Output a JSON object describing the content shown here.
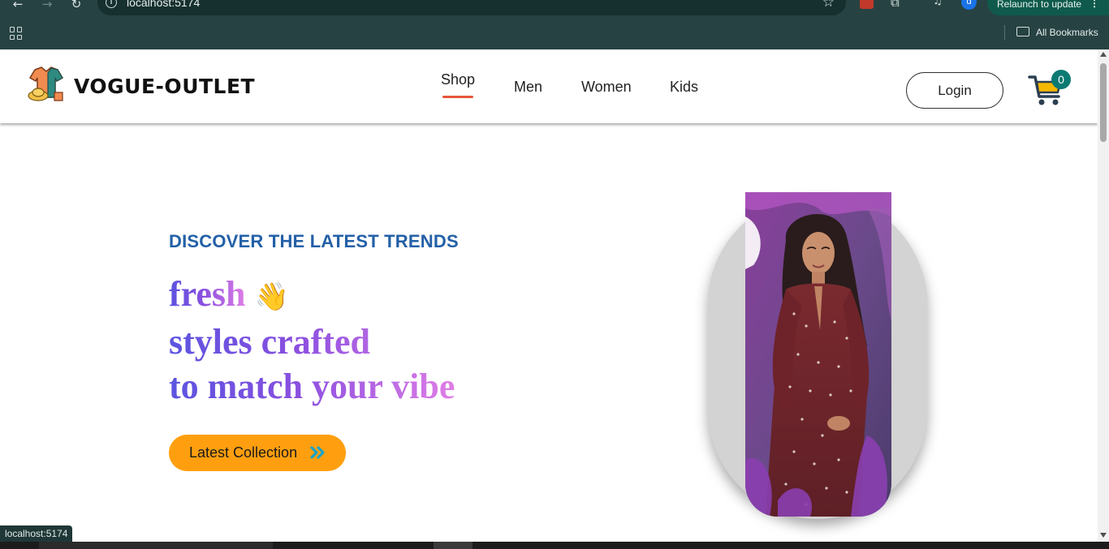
{
  "browser": {
    "url": "localhost:5174",
    "relaunch_label": "Relaunch to update",
    "relaunch_dots": "⋮",
    "profile_initial": "d",
    "bookmarks_label": "All Bookmarks",
    "status_text": "localhost:5174",
    "icons": [
      "back-arrow-icon",
      "forward-arrow-icon",
      "reload-icon",
      "info-icon",
      "star-icon",
      "extension-icon",
      "puzzle-icon",
      "media-icon",
      "apps-grid-icon",
      "folder-icon"
    ]
  },
  "nav": {
    "brand": "VOGUE-OUTLET",
    "links": [
      {
        "label": "Shop",
        "active": true
      },
      {
        "label": "Men",
        "active": false
      },
      {
        "label": "Women",
        "active": false
      },
      {
        "label": "Kids",
        "active": false
      }
    ],
    "login_label": "Login",
    "cart_count": "0",
    "accent_color": "#e8553a"
  },
  "hero": {
    "eyebrow": "DISCOVER THE LATEST TRENDS",
    "line1_word": "fresh",
    "line1_emoji": "👋",
    "line2": "styles crafted",
    "line3": "to match your vibe",
    "cta_label": "Latest Collection",
    "cta_color": "#ff9f0f",
    "heading_color": "#2360a7"
  }
}
